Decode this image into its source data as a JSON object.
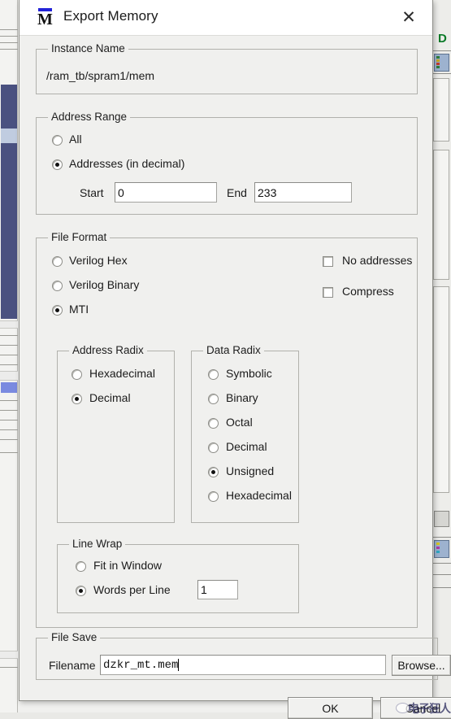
{
  "window": {
    "title": "Export Memory",
    "icon": "modelsim-m-icon",
    "close_label": "✕"
  },
  "instance_name": {
    "legend": "Instance Name",
    "value": "/ram_tb/spram1/mem"
  },
  "address_range": {
    "legend": "Address Range",
    "options": [
      {
        "label": "All",
        "selected": false
      },
      {
        "label": "Addresses (in decimal)",
        "selected": true
      }
    ],
    "start_label": "Start",
    "start_value": "0",
    "end_label": "End",
    "end_value": "233"
  },
  "file_format": {
    "legend": "File Format",
    "options": [
      {
        "label": "Verilog Hex",
        "selected": false
      },
      {
        "label": "Verilog Binary",
        "selected": false
      },
      {
        "label": "MTI",
        "selected": true
      }
    ],
    "checkboxes": [
      {
        "label": "No addresses",
        "checked": false
      },
      {
        "label": "Compress",
        "checked": false
      }
    ]
  },
  "address_radix": {
    "legend": "Address Radix",
    "options": [
      {
        "label": "Hexadecimal",
        "selected": false
      },
      {
        "label": "Decimal",
        "selected": true
      }
    ]
  },
  "data_radix": {
    "legend": "Data Radix",
    "options": [
      {
        "label": "Symbolic",
        "selected": false
      },
      {
        "label": "Binary",
        "selected": false
      },
      {
        "label": "Octal",
        "selected": false
      },
      {
        "label": "Decimal",
        "selected": false
      },
      {
        "label": "Unsigned",
        "selected": true
      },
      {
        "label": "Hexadecimal",
        "selected": false
      }
    ]
  },
  "line_wrap": {
    "legend": "Line Wrap",
    "options": [
      {
        "label": "Fit in Window",
        "selected": false
      },
      {
        "label": "Words per Line",
        "selected": true
      }
    ],
    "words_per_line_value": "1"
  },
  "file_save": {
    "legend": "File Save",
    "filename_label": "Filename",
    "filename_value": "dzkr_mt.mem",
    "browse_label": "Browse..."
  },
  "actions": {
    "ok_label": "OK",
    "cancel_label": "Cancel",
    "cancel_watermark": "电子狂人"
  },
  "colors": {
    "dialog_bg": "#f0f0ee",
    "titlebar_bg": "#ffffff",
    "group_border": "#b1b1ac",
    "accent_blue": "#2323d8",
    "bg_scroll_navy": "#4a5180",
    "bg_selection_blue": "#7a8ae0",
    "bg_green": "#0a7a28"
  }
}
